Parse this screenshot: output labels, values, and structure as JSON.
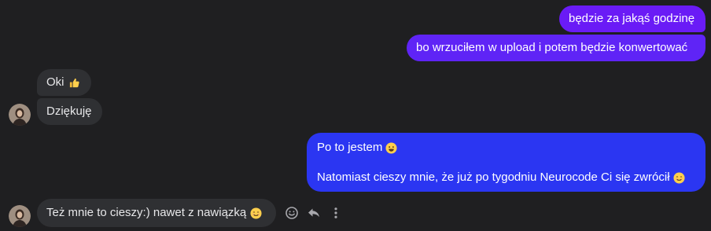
{
  "colors": {
    "background": "#1f1f21",
    "outgoing_purple": "#6a1bf6",
    "outgoing_blue": "#2b36f2",
    "incoming": "#2f3033"
  },
  "messages": {
    "out1": {
      "text": "będzie za jakąś godzinę"
    },
    "out2": {
      "text": "bo wrzuciłem w upload i potem będzie konwertować"
    },
    "in1": {
      "text": "Oki",
      "emoji": "thumbs-up-emoji"
    },
    "in2": {
      "text": "Dziękuję"
    },
    "out3": {
      "line1": "Po to jestem",
      "line1_emoji": "grinning-face-emoji",
      "line2": "Natomiast cieszy mnie, że już po tygodniu Neurocode Ci się zwrócił",
      "line2_emoji": "smiling-face-emoji"
    },
    "in3": {
      "text": "Też mnie to cieszy:) nawet z nawiązką",
      "emoji": "smiling-face-emoji"
    }
  },
  "actions": {
    "react_icon": "emoji-react-icon",
    "reply_icon": "reply-icon",
    "more_icon": "more-options-icon"
  }
}
